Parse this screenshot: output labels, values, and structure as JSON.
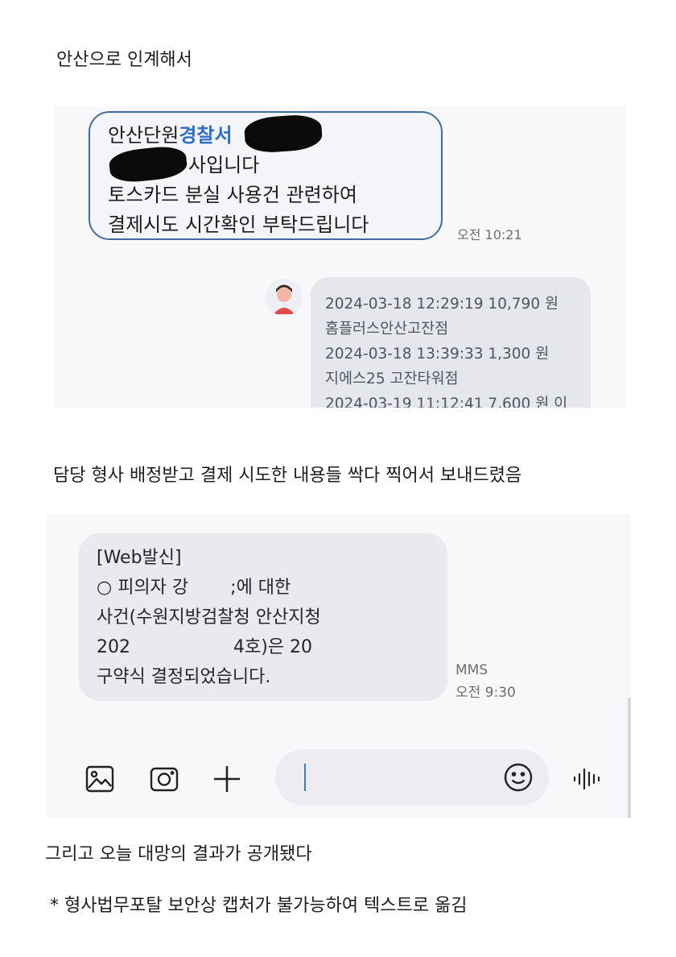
{
  "captions": {
    "top": "안산으로 인계해서",
    "middle": "담당 형사 배정받고 결제 시도한 내용들 싹다 찍어서 보내드렸음",
    "bottom1": "그리고 오늘 대망의 결과가 공개됐다",
    "bottom2": "* 형사법무포탈 보안상 캡처가 불가능하여 텍스트로 옮김"
  },
  "chat1": {
    "incoming": {
      "line1_prefix": "안산단원",
      "line1_highlight": "경찰서",
      "line2_visible": "사입니다",
      "line3": "토스카드 분실 사용건 관련하여",
      "line4": "결제시도 시간확인 부탁드립니다"
    },
    "incoming_time": "오전 10:21",
    "outgoing": {
      "lines": [
        "2024-03-18 12:29:19 10,790 원",
        "홈플러스안산고잔점",
        "2024-03-18 13:39:33 1,300 원",
        "지에스25 고잔타워점",
        "2024-03-19 11:12:41 7,600 원 이"
      ]
    }
  },
  "chat2": {
    "mms": {
      "line1": "[Web발신]",
      "line2a": "○ 피의자 강",
      "line2b": ";에 대한",
      "line3": "사건(수원지방검찰청 안산지청",
      "line4a": "202",
      "line4b": "4호)은 20",
      "line5": "구약식 결정되었습니다."
    },
    "meta_type": "MMS",
    "meta_time": "오전 9:30"
  },
  "icons": {
    "gallery": "image-icon",
    "camera": "camera-icon",
    "plus": "plus-icon",
    "emoji": "emoji-icon",
    "voice": "voice-wave-icon"
  },
  "colors": {
    "highlight": "#2a6fcf",
    "bubble_border": "#3f6e9d",
    "cursor": "#3a7bd5"
  }
}
